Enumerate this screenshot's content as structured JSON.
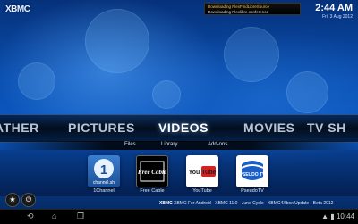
{
  "app": {
    "logo_text": "XBMC"
  },
  "notification": {
    "line1": "Downloading PlexFindLibreSource",
    "line2": "Downloading Plexlibre.conference"
  },
  "clock": {
    "time": "2:44 AM",
    "date": "Fri, 3 Aug 2012"
  },
  "main_menu": {
    "items": [
      {
        "label": "ATHER"
      },
      {
        "label": "PICTURES"
      },
      {
        "label": "VIDEOS"
      },
      {
        "label": "MOVIES"
      },
      {
        "label": "TV SH"
      }
    ],
    "active": "VIDEOS"
  },
  "sub_menu": {
    "items": [
      {
        "label": "Files"
      },
      {
        "label": "Library"
      },
      {
        "label": "Add-ons"
      }
    ]
  },
  "favourites": [
    {
      "label": "1Channel",
      "icon": "1channel-logo-icon",
      "logo_text": "1",
      "logo_sub": "channel.sh"
    },
    {
      "label": "Free Cable",
      "icon": "free-cable-logo-icon",
      "logo_text": "Free Cable"
    },
    {
      "label": "YouTube",
      "icon": "youtube-logo-icon",
      "logo_text": "You Tube"
    },
    {
      "label": "PseudoTV",
      "icon": "pseudo-tv-logo-icon",
      "logo_text": "PSEUDO TV"
    }
  ],
  "ticker": {
    "prefix": "XBMC",
    "text": "XBMC For Android - XBMC 11.0 - June Cycle - XBMC4Xbox Update - Beta 2012"
  },
  "navbar": {
    "status_time": "10:44"
  },
  "colors": {
    "background": "#0a4fb0",
    "menu_active": "#ffffff",
    "menu_inactive": "#b8c4d6"
  }
}
